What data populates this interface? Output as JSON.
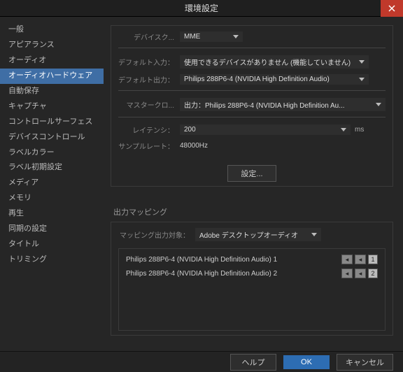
{
  "window": {
    "title": "環境設定"
  },
  "sidebar": {
    "items": [
      {
        "label": "一般"
      },
      {
        "label": "アピアランス"
      },
      {
        "label": "オーディオ"
      },
      {
        "label": "オーディオハードウェア",
        "selected": true
      },
      {
        "label": "自動保存"
      },
      {
        "label": "キャプチャ"
      },
      {
        "label": "コントロールサーフェス"
      },
      {
        "label": "デバイスコントロール"
      },
      {
        "label": "ラベルカラー"
      },
      {
        "label": "ラベル初期設定"
      },
      {
        "label": "メディア"
      },
      {
        "label": "メモリ"
      },
      {
        "label": "再生"
      },
      {
        "label": "同期の設定"
      },
      {
        "label": "タイトル"
      },
      {
        "label": "トリミング"
      }
    ]
  },
  "panel": {
    "device_class": {
      "label": "デバイスク...",
      "value": "MME"
    },
    "default_input": {
      "label": "デフォルト入力：",
      "value": "使用できるデバイスがありません (機能していません)"
    },
    "default_output": {
      "label": "デフォルト出力：",
      "value": "Philips 288P6-4 (NVIDIA High Definition Audio)"
    },
    "master_clock": {
      "label": "マスタークロ...",
      "value": "出力：Philips 288P6-4 (NVIDIA High Definition Au..."
    },
    "latency": {
      "label": "レイテンシ：",
      "value": "200",
      "unit": "ms"
    },
    "sample_rate": {
      "label": "サンプルレート：",
      "value": "48000Hz"
    },
    "settings_btn": "設定..."
  },
  "mapping": {
    "title": "出力マッピング",
    "target_label": "マッピング出力対象：",
    "target_value": "Adobe デスクトップオーディオ",
    "rows": [
      {
        "name": "Philips 288P6-4 (NVIDIA High Definition Audio) 1",
        "num": "1"
      },
      {
        "name": "Philips 288P6-4 (NVIDIA High Definition Audio) 2",
        "num": "2"
      }
    ]
  },
  "footer": {
    "help": "ヘルプ",
    "ok": "OK",
    "cancel": "キャンセル"
  }
}
